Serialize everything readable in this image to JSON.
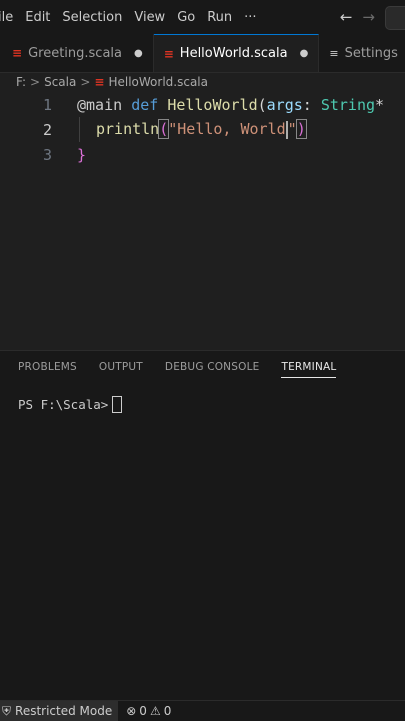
{
  "menu": {
    "items": [
      "ile",
      "Edit",
      "Selection",
      "View",
      "Go",
      "Run",
      "···"
    ],
    "back_icon": "arrow-left-icon",
    "forward_icon": "arrow-right-icon"
  },
  "tabs": [
    {
      "label": "Greeting.scala",
      "icon": "scala-icon",
      "marker": "●"
    },
    {
      "label": "HelloWorld.scala",
      "icon": "scala-icon",
      "marker": "●"
    },
    {
      "label": "Settings",
      "icon": "settings-icon"
    }
  ],
  "glyphs": {
    "scala": "≡",
    "settings": "≡",
    "chevron": ">",
    "back": "←",
    "forward": "→",
    "error": "⊗",
    "warning": "⚠",
    "restricted": "⛨"
  },
  "breadcrumb": [
    "F:",
    "Scala",
    "HelloWorld.scala"
  ],
  "editor": {
    "line_numbers": [
      "1",
      "2",
      "3"
    ],
    "line1": {
      "t1": "@main",
      "t2": " ",
      "t3": "def",
      "t4": " ",
      "t5": "HelloWorld",
      "t6": "(",
      "t7": "args",
      "t8": ": ",
      "t9": "String",
      "t10": "*"
    },
    "line2": {
      "t1": "println",
      "t2": "(",
      "t3": "\"Hello, World",
      "t4": "\"",
      "t5": ")"
    },
    "line3": {
      "t1": "}"
    }
  },
  "panel": {
    "tabs": [
      "PROBLEMS",
      "OUTPUT",
      "DEBUG CONSOLE",
      "TERMINAL"
    ],
    "active_tab": "TERMINAL",
    "terminal_prompt": "PS F:\\Scala>"
  },
  "status": {
    "restricted_mode": "Restricted Mode",
    "errors": "0",
    "warnings": "0"
  }
}
